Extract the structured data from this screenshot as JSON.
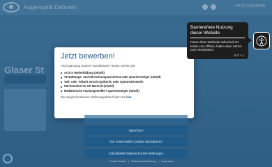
{
  "site": {
    "title": "Augenoptik Dahmen",
    "phone": "+49 (0) 1234 56789"
  },
  "hero": {
    "text": "Glaser St"
  },
  "modal": {
    "title": "Jetzt bewerben!",
    "intro": "Als Ergänzung unseres wunderbaren Teams suchen wir:",
    "jobs": [
      "Arzt in Weiterbildung (m/w/d)",
      "Verwaltungs- und Abrechnungsassistenz oder Quereinsteiger (m/w/d)",
      "Voll- oder Teilzeit stroch Optiker/in oder Optometristen/in",
      "Werkstudent im OP-Bereich (m/w/d)",
      "Medizinische Fachangestellte / Quereinsteiger (m/w/d)"
    ],
    "footer_prefix": "Die ausgeschriebenen Stellenangebote finden Sie",
    "footer_link": "hier."
  },
  "a11y_tooltip": {
    "title": "Barrierefreie Nutzung dieser Website",
    "text": "Passe diese Webseite individuell an! Klicke zum Öffnen, halten dann ziehen zum Verschieben.",
    "shortcut": "ALT + 1"
  },
  "consent": {
    "save": "Speichern",
    "essential_only": "Nur essenzielle Cookies akzeptieren",
    "individual": "Individuelle Datenschutzeinstellungen"
  },
  "footer": {
    "links": [
      "Cookie-Details",
      "Datenschutzerklärung",
      "Impressum"
    ]
  }
}
